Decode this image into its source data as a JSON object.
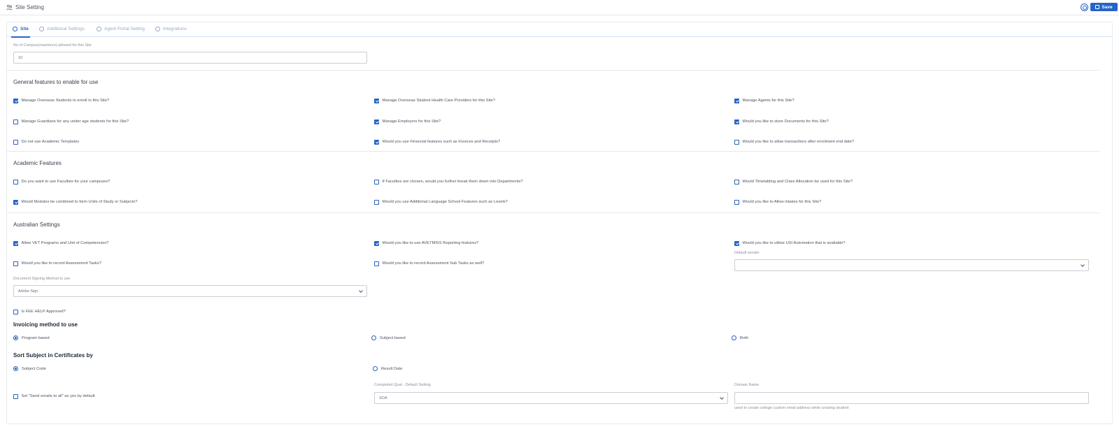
{
  "header": {
    "title": "Site Setting",
    "save_label": "Save",
    "help_icon": "help-circle-icon",
    "colors": {
      "accent": "#2563c9"
    }
  },
  "tabs": [
    {
      "label": "Site",
      "icon": "users-icon",
      "active": true
    },
    {
      "label": "Additional Settings",
      "icon": "settings-users-icon",
      "active": false
    },
    {
      "label": "Agent Portal Setting",
      "icon": "building-icon",
      "active": false
    },
    {
      "label": "Integrations",
      "icon": "cloud-icon",
      "active": false
    }
  ],
  "campus": {
    "label": "No of Campus(maximum) allowed for this Site",
    "value": "10"
  },
  "general": {
    "title": "General features to enable for use",
    "options": [
      {
        "label": "Manage Overseas Students to enroll in this Site?",
        "checked": true
      },
      {
        "label": "Manage Overseas Student Health Care Providers for this Site?",
        "checked": true
      },
      {
        "label": "Manage Agents for this Site?",
        "checked": true
      },
      {
        "label": "Manage Guardians for any under age students for this Site?",
        "checked": false
      },
      {
        "label": "Manage Employers for this Site?",
        "checked": true
      },
      {
        "label": "Would you like to store Documents for this Site?",
        "checked": true
      },
      {
        "label": "Do not use Academic Templates",
        "checked": false
      },
      {
        "label": "Would you use Financial features such as Invoices and Receipts?",
        "checked": true
      },
      {
        "label": "Would you like to allow transactions after enrolment end date?",
        "checked": false
      }
    ]
  },
  "academic": {
    "title": "Academic Features",
    "options": [
      {
        "label": "Do you want to use Faculties for your campuses?",
        "checked": false
      },
      {
        "label": "If Faculties are chosen, would you further break them down into Departments?",
        "checked": false
      },
      {
        "label": "Would Timetabling and Class Allocation be used for this Site?",
        "checked": false
      },
      {
        "label": "Would Modules be combined to form Units of Study or Subjects?",
        "checked": true
      },
      {
        "label": "Would you use Additional Language School Features such as Levels?",
        "checked": false
      },
      {
        "label": "Would you like to Allow intakes for this Site?",
        "checked": false
      }
    ]
  },
  "australian": {
    "title": "Australian Settings",
    "options": [
      {
        "label": "Allow VET Programs and Unit of Competencies?",
        "checked": true
      },
      {
        "label": "Would you like to use AVETMISS Reporting features?",
        "checked": true
      },
      {
        "label": "Would you like to utilise USI Automation that is available?",
        "checked": true
      },
      {
        "label": "Would you like to record Assessment Tasks?",
        "checked": false
      },
      {
        "label": "Would you like to record Assessment Sub Tasks as well?",
        "checked": false
      }
    ],
    "default_sender_label": "Default sender",
    "default_sender_value": "",
    "doc_signing_label": "Document Signing Method to use",
    "doc_signing_value": "Adobe Sign",
    "fee_help": {
      "label": "Is FEE HELP Approved?",
      "checked": false
    }
  },
  "invoicing": {
    "title": "Invoicing method to use",
    "options": [
      {
        "label": "Program based",
        "selected": true
      },
      {
        "label": "Subject based",
        "selected": false
      },
      {
        "label": "Both",
        "selected": false
      }
    ]
  },
  "sort": {
    "title": "Sort Subject in Certificates by",
    "options": [
      {
        "label": "Subject Code",
        "selected": true
      },
      {
        "label": "Result Date",
        "selected": false
      }
    ]
  },
  "bottom": {
    "send_emails": {
      "label": "Set \"Send emails to all\" as yes by default",
      "checked": false
    },
    "completed_qual_label": "Completed Qual - Default Setting",
    "completed_qual_value": "SOA",
    "domain_label": "Domain Name",
    "domain_value": "",
    "domain_hint": "used to create college custom email address while creating student"
  }
}
